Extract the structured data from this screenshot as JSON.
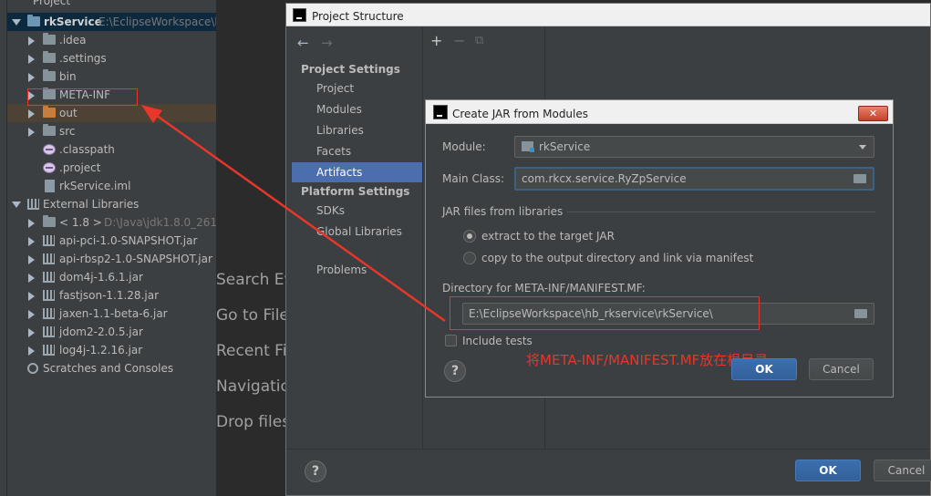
{
  "project_panel": {
    "header": "Project",
    "tree": [
      {
        "label": "rkService",
        "path": "E:\\EclipseWorkspace\\hb_rkservice",
        "icon": "module-folder-icon",
        "expanded": true
      },
      {
        "label": ".idea",
        "icon": "folder-icon"
      },
      {
        "label": ".settings",
        "icon": "folder-icon"
      },
      {
        "label": "bin",
        "icon": "folder-icon"
      },
      {
        "label": "META-INF",
        "icon": "folder-icon"
      },
      {
        "label": "out",
        "icon": "orange-folder-icon"
      },
      {
        "label": "src",
        "icon": "folder-icon"
      },
      {
        "label": ".classpath",
        "icon": "classpath-file-icon"
      },
      {
        "label": ".project",
        "icon": "project-file-icon"
      },
      {
        "label": "rkService.iml",
        "icon": "iml-file-icon"
      },
      {
        "label": "External Libraries",
        "icon": "library-icon",
        "expanded": true
      },
      {
        "label": "< 1.8 >",
        "path": "D:\\Java\\jdk1.8.0_261",
        "icon": "jdk-icon"
      },
      {
        "label": "api-pci-1.0-SNAPSHOT.jar",
        "icon": "jar-icon"
      },
      {
        "label": "api-rbsp2-1.0-SNAPSHOT.jar",
        "icon": "jar-icon"
      },
      {
        "label": "dom4j-1.6.1.jar",
        "icon": "jar-icon"
      },
      {
        "label": "fastjson-1.1.28.jar",
        "icon": "jar-icon"
      },
      {
        "label": "jaxen-1.1-beta-6.jar",
        "icon": "jar-icon"
      },
      {
        "label": "jdom2-2.0.5.jar",
        "icon": "jar-icon"
      },
      {
        "label": "log4j-1.2.16.jar",
        "icon": "jar-icon"
      },
      {
        "label": "Scratches and Consoles",
        "icon": "scratches-icon"
      }
    ]
  },
  "editor_hints": [
    "Search Eve",
    "Go to File",
    "Recent File",
    "Navigation",
    "Drop files"
  ],
  "project_structure": {
    "title": "Project Structure",
    "project_settings_heading": "Project Settings",
    "project_settings_items": [
      "Project",
      "Modules",
      "Libraries",
      "Facets",
      "Artifacts"
    ],
    "active_item": "Artifacts",
    "platform_settings_heading": "Platform Settings",
    "platform_settings_items": [
      "SDKs",
      "Global Libraries"
    ],
    "problems_label": "Problems",
    "toolbar": {
      "add": "+",
      "remove": "−",
      "copy": "⧉"
    },
    "ok_label": "OK",
    "cancel_label": "Cancel",
    "help_label": "?"
  },
  "jar_dialog": {
    "title": "Create JAR from Modules",
    "close_label": "✕",
    "module_label": "Module:",
    "module_value": "rkService",
    "main_class_label": "Main Class:",
    "main_class_value": "com.rkcx.service.RyZpService",
    "jar_files_heading": "JAR files from libraries",
    "radio_extract": "extract to the target JAR",
    "radio_copy": "copy to the output directory and link via manifest",
    "selected_option": "extract",
    "manifest_dir_label": "Directory for META-INF/MANIFEST.MF:",
    "manifest_dir_value": "E:\\EclipseWorkspace\\hb_rkservice\\rkService\\",
    "include_tests_label": "Include tests",
    "include_tests_checked": false,
    "ok_label": "OK",
    "cancel_label": "Cancel",
    "help_label": "?"
  },
  "annotation": {
    "text": "将META-INF/MANIFEST.MF放在根目录",
    "color": "#e8362a"
  }
}
